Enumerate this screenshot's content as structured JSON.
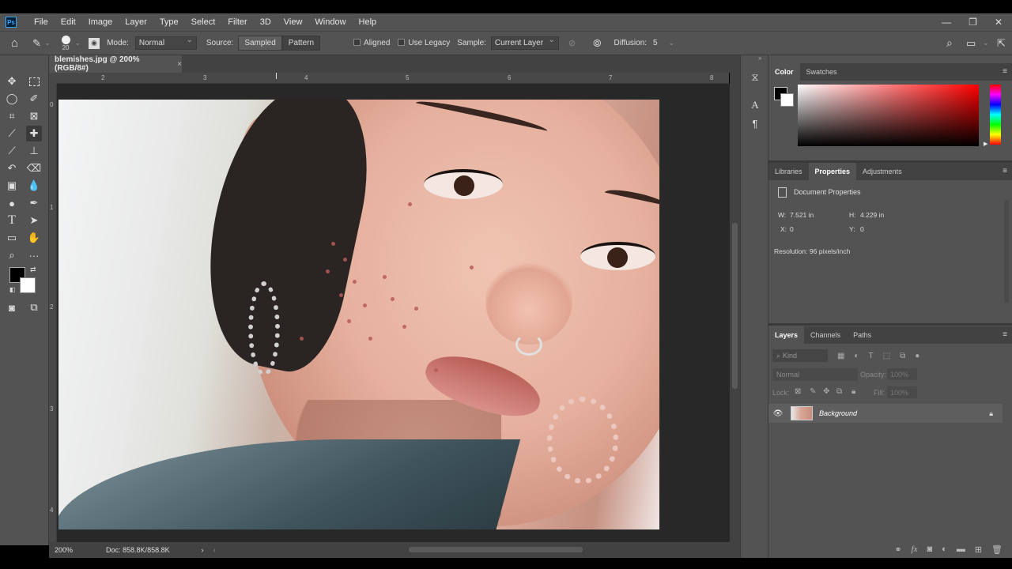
{
  "menubar": {
    "logo": "Ps",
    "items": [
      "File",
      "Edit",
      "Image",
      "Layer",
      "Type",
      "Select",
      "Filter",
      "3D",
      "View",
      "Window",
      "Help"
    ]
  },
  "options": {
    "brush_size": "20",
    "mode_label": "Mode:",
    "mode_value": "Normal",
    "source_label": "Source:",
    "sampled_btn": "Sampled",
    "pattern_btn": "Pattern",
    "aligned_label": "Aligned",
    "legacy_label": "Use Legacy",
    "sample_label": "Sample:",
    "sample_value": "Current Layer",
    "diffusion_label": "Diffusion:",
    "diffusion_value": "5"
  },
  "document": {
    "tab_title": "blemishes.jpg @ 200% (RGB/8#)",
    "tab_close": "×",
    "zoom": "200%",
    "doc_size": "Doc: 858.8K/858.8K",
    "status_arrow": "›",
    "scroll_arrow": "‹"
  },
  "ruler": {
    "h_ticks": [
      "2",
      "3",
      "4",
      "5",
      "6",
      "7",
      "8"
    ],
    "v_ticks": [
      "0",
      "1",
      "2",
      "3",
      "4"
    ]
  },
  "color_panel": {
    "tabs": [
      "Color",
      "Swatches"
    ],
    "foreground": "#000000",
    "background": "#ffffff"
  },
  "properties_panel": {
    "tabs": [
      "Libraries",
      "Properties",
      "Adjustments"
    ],
    "header": "Document Properties",
    "w_label": "W:",
    "w_value": "7.521 in",
    "h_label": "H:",
    "h_value": "4.229 in",
    "x_label": "X:",
    "x_value": "0",
    "y_label": "Y:",
    "y_value": "0",
    "resolution": "Resolution: 96 pixels/inch"
  },
  "layers_panel": {
    "tabs": [
      "Layers",
      "Channels",
      "Paths"
    ],
    "kind_placeholder": "Kind",
    "blend_mode": "Normal",
    "opacity_label": "Opacity:",
    "opacity_value": "100%",
    "lock_label": "Lock:",
    "fill_label": "Fill:",
    "fill_value": "100%",
    "layers": [
      {
        "name": "Background",
        "visible": true,
        "locked": true
      }
    ]
  },
  "window_controls": [
    "—",
    "❐",
    "✕"
  ]
}
